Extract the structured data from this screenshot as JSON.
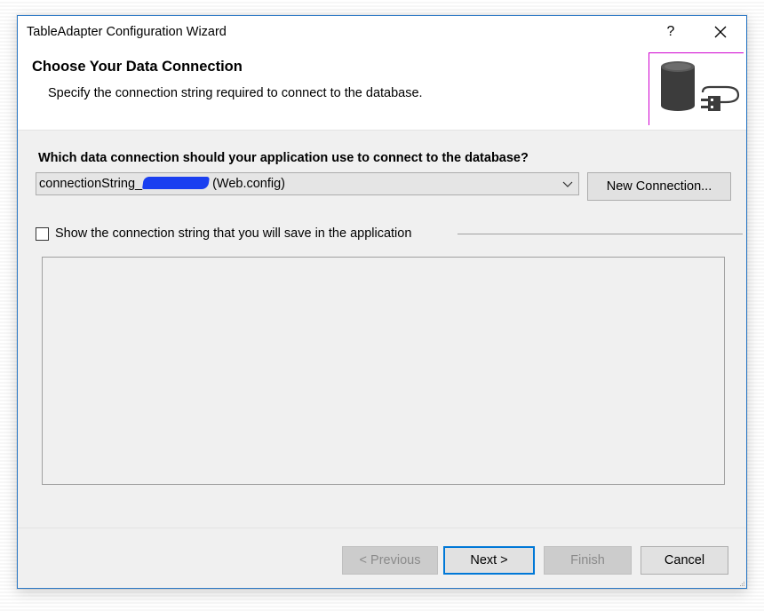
{
  "window": {
    "title": "TableAdapter Configuration Wizard",
    "help_label": "?",
    "accent_border": "#2b78c5"
  },
  "header": {
    "title": "Choose Your Data Connection",
    "subtitle": "Specify the connection string required to connect to the database.",
    "art_icon": "database-plug-icon"
  },
  "connection": {
    "question": "Which data connection should your application use to connect to the database?",
    "selected_prefix": "connectionString_",
    "selected_suffix": "(Web.config)",
    "new_connection_label": "New Connection..."
  },
  "show_string": {
    "label": "Show the connection string that you will save in the application",
    "checked": false
  },
  "footer": {
    "previous_label": "< Previous",
    "next_label": "Next >",
    "finish_label": "Finish",
    "cancel_label": "Cancel"
  },
  "colors": {
    "redaction": "#1a3ff0",
    "focus": "#0078d7"
  }
}
